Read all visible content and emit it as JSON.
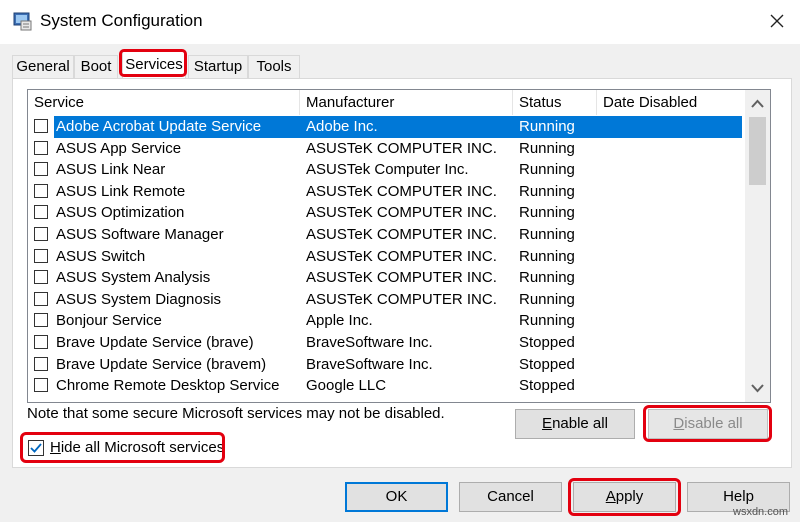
{
  "window": {
    "title": "System Configuration",
    "app_icon": "msconfig-icon",
    "close_icon": "close-icon"
  },
  "tabs": [
    {
      "label": "General",
      "active": false
    },
    {
      "label": "Boot",
      "active": false
    },
    {
      "label": "Services",
      "active": true
    },
    {
      "label": "Startup",
      "active": false
    },
    {
      "label": "Tools",
      "active": false
    }
  ],
  "columns": {
    "service": "Service",
    "manufacturer": "Manufacturer",
    "status": "Status",
    "date_disabled": "Date Disabled"
  },
  "services": [
    {
      "name": "Adobe Acrobat Update Service",
      "manufacturer": "Adobe Inc.",
      "status": "Running",
      "date_disabled": "",
      "checked": false,
      "selected": true
    },
    {
      "name": "ASUS App Service",
      "manufacturer": "ASUSTeK COMPUTER INC.",
      "status": "Running",
      "date_disabled": "",
      "checked": false,
      "selected": false
    },
    {
      "name": "ASUS Link Near",
      "manufacturer": "ASUSTek Computer Inc.",
      "status": "Running",
      "date_disabled": "",
      "checked": false,
      "selected": false
    },
    {
      "name": "ASUS Link Remote",
      "manufacturer": "ASUSTeK COMPUTER INC.",
      "status": "Running",
      "date_disabled": "",
      "checked": false,
      "selected": false
    },
    {
      "name": "ASUS Optimization",
      "manufacturer": "ASUSTeK COMPUTER INC.",
      "status": "Running",
      "date_disabled": "",
      "checked": false,
      "selected": false
    },
    {
      "name": "ASUS Software Manager",
      "manufacturer": "ASUSTeK COMPUTER INC.",
      "status": "Running",
      "date_disabled": "",
      "checked": false,
      "selected": false
    },
    {
      "name": "ASUS Switch",
      "manufacturer": "ASUSTeK COMPUTER INC.",
      "status": "Running",
      "date_disabled": "",
      "checked": false,
      "selected": false
    },
    {
      "name": "ASUS System Analysis",
      "manufacturer": "ASUSTeK COMPUTER INC.",
      "status": "Running",
      "date_disabled": "",
      "checked": false,
      "selected": false
    },
    {
      "name": "ASUS System Diagnosis",
      "manufacturer": "ASUSTeK COMPUTER INC.",
      "status": "Running",
      "date_disabled": "",
      "checked": false,
      "selected": false
    },
    {
      "name": "Bonjour Service",
      "manufacturer": "Apple Inc.",
      "status": "Running",
      "date_disabled": "",
      "checked": false,
      "selected": false
    },
    {
      "name": "Brave Update Service (brave)",
      "manufacturer": "BraveSoftware Inc.",
      "status": "Stopped",
      "date_disabled": "",
      "checked": false,
      "selected": false
    },
    {
      "name": "Brave Update Service (bravem)",
      "manufacturer": "BraveSoftware Inc.",
      "status": "Stopped",
      "date_disabled": "",
      "checked": false,
      "selected": false
    },
    {
      "name": "Chrome Remote Desktop Service",
      "manufacturer": "Google LLC",
      "status": "Stopped",
      "date_disabled": "",
      "checked": false,
      "selected": false
    }
  ],
  "scrollbar": {
    "up_icon": "scroll-up-arrow-icon",
    "down_icon": "scroll-down-arrow-icon"
  },
  "note": "Note that some secure Microsoft services may not be disabled.",
  "buttons": {
    "enable_all": "Enable all",
    "disable_all": "Disable all",
    "ok": "OK",
    "cancel": "Cancel",
    "apply": "Apply",
    "help": "Help"
  },
  "hide_ms": {
    "label": "Hide all Microsoft services",
    "checked": true,
    "check_icon": "checkmark-icon"
  },
  "watermark": "wsxdn.com",
  "colors": {
    "highlight_red": "#e3000f",
    "selection_blue": "#0078d7",
    "checkbox_blue": "#0067c0"
  }
}
